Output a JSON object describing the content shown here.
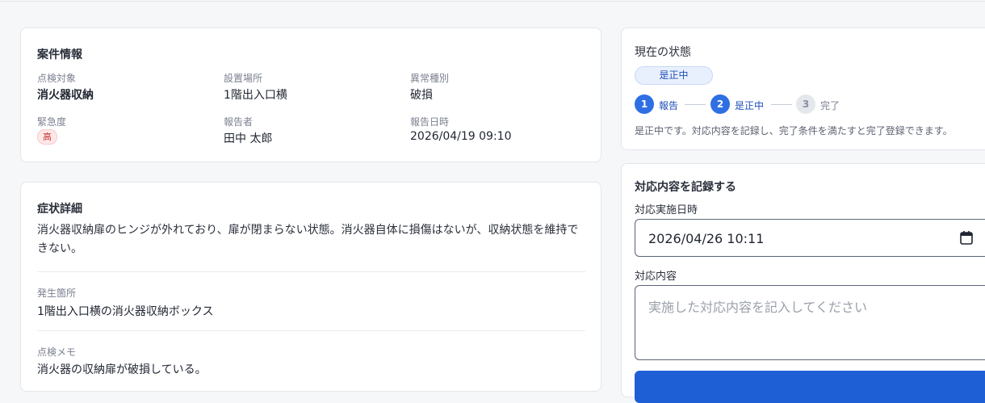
{
  "case_info": {
    "title": "案件情報",
    "fields": [
      {
        "label": "点検対象",
        "value": "消火器収納"
      },
      {
        "label": "設置場所",
        "value": "1階出入口横"
      },
      {
        "label": "異常種別",
        "value": "破損"
      },
      {
        "label": "緊急度",
        "value": "高"
      },
      {
        "label": "報告者",
        "value": "田中 太郎"
      },
      {
        "label": "報告日時",
        "value": "2026/04/19 09:10"
      }
    ]
  },
  "symptom": {
    "title": "症状詳細",
    "description_line1": "消火器収納扉のヒンジが外れており、扉が閉まらない状態。消火器自体に損傷はないが、収納状態を維持で",
    "description_line2": "きない。",
    "location_label": "発生箇所",
    "location_value": "1階出入口横の消火器収納ボックス",
    "memo_label": "点検メモ",
    "memo_value": "消火器の収納扉が破損している。"
  },
  "status": {
    "title": "現在の状態",
    "current": "是正中",
    "steps": [
      {
        "num": "1",
        "label": "報告",
        "state": "active"
      },
      {
        "num": "2",
        "label": "是正中",
        "state": "active"
      },
      {
        "num": "3",
        "label": "完了",
        "state": "pending"
      }
    ],
    "note": "是正中です。対応内容を記録し、完了条件を満たすと完了登録できます。"
  },
  "record": {
    "title": "対応内容を記録する",
    "date_label": "対応実施日時",
    "date_value": "2026/04/26 10:11",
    "content_label": "対応内容",
    "content_placeholder": "実施した対応内容を記入してください"
  },
  "colors": {
    "accent": "#2f6fe4",
    "danger": "#c8312f"
  }
}
